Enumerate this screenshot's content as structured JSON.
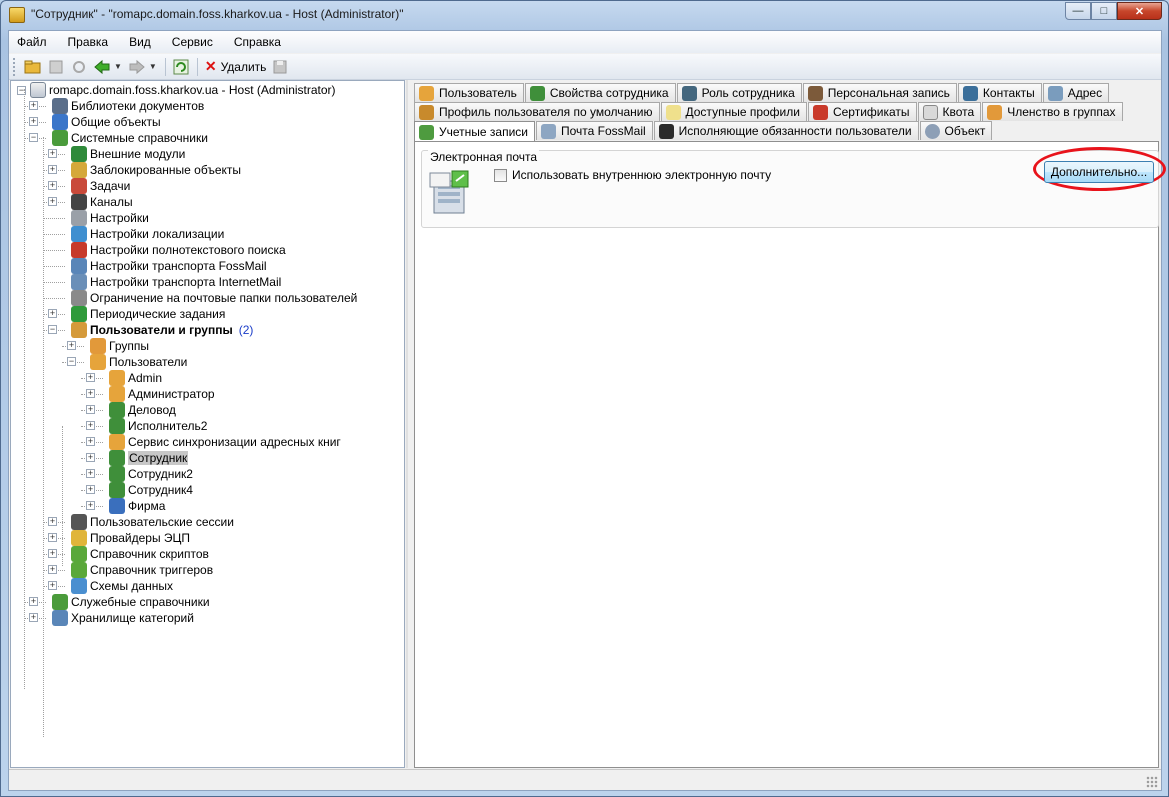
{
  "window": {
    "title": "\"Сотрудник\" - \"romapc.domain.foss.kharkov.ua - Host (Administrator)\""
  },
  "menu": [
    {
      "label": "Файл"
    },
    {
      "label": "Правка"
    },
    {
      "label": "Вид"
    },
    {
      "label": "Сервис"
    },
    {
      "label": "Справка"
    }
  ],
  "toolbar": {
    "delete_label": "Удалить"
  },
  "tree": {
    "root": "romapc.domain.foss.kharkov.ua - Host (Administrator)",
    "items": [
      {
        "label": "Библиотеки документов"
      },
      {
        "label": "Общие объекты"
      },
      {
        "label": "Системные справочники"
      },
      {
        "label": "Внешние модули"
      },
      {
        "label": "Заблокированные объекты"
      },
      {
        "label": "Задачи"
      },
      {
        "label": "Каналы"
      },
      {
        "label": "Настройки"
      },
      {
        "label": "Настройки локализации"
      },
      {
        "label": "Настройки полнотекстового поиска"
      },
      {
        "label": "Настройки транспорта FossMail"
      },
      {
        "label": "Настройки транспорта InternetMail"
      },
      {
        "label": "Ограничение на почтовые папки пользователей"
      },
      {
        "label": "Периодические задания"
      },
      {
        "label": "Пользователи и группы",
        "count": "(2)"
      },
      {
        "label": "Группы"
      },
      {
        "label": "Пользователи"
      },
      {
        "label": "Admin"
      },
      {
        "label": "Администратор"
      },
      {
        "label": "Деловод"
      },
      {
        "label": "Исполнитель2"
      },
      {
        "label": "Сервис синхронизации адресных книг"
      },
      {
        "label": "Сотрудник"
      },
      {
        "label": "Сотрудник2"
      },
      {
        "label": "Сотрудник4"
      },
      {
        "label": "Фирма"
      },
      {
        "label": "Пользовательские сессии"
      },
      {
        "label": "Провайдеры ЭЦП"
      },
      {
        "label": "Справочник скриптов"
      },
      {
        "label": "Справочник триггеров"
      },
      {
        "label": "Схемы данных"
      },
      {
        "label": "Служебные справочники"
      },
      {
        "label": "Хранилище категорий"
      }
    ]
  },
  "tabs": {
    "row1": [
      "Пользователь",
      "Свойства сотрудника",
      "Роль сотрудника",
      "Персональная запись",
      "Контакты",
      "Адрес"
    ],
    "row2": [
      "Профиль пользователя по умолчанию",
      "Доступные профили",
      "Сертификаты",
      "Квота",
      "Членство в группах"
    ],
    "row3": [
      "Учетные записи",
      "Почта FossMail",
      "Исполняющие обязанности пользователи",
      "Объект"
    ]
  },
  "email_group": {
    "title": "Электронная почта",
    "checkbox_label": "Использовать внутреннюю электронную почту",
    "advanced_button": "Дополнительно..."
  }
}
